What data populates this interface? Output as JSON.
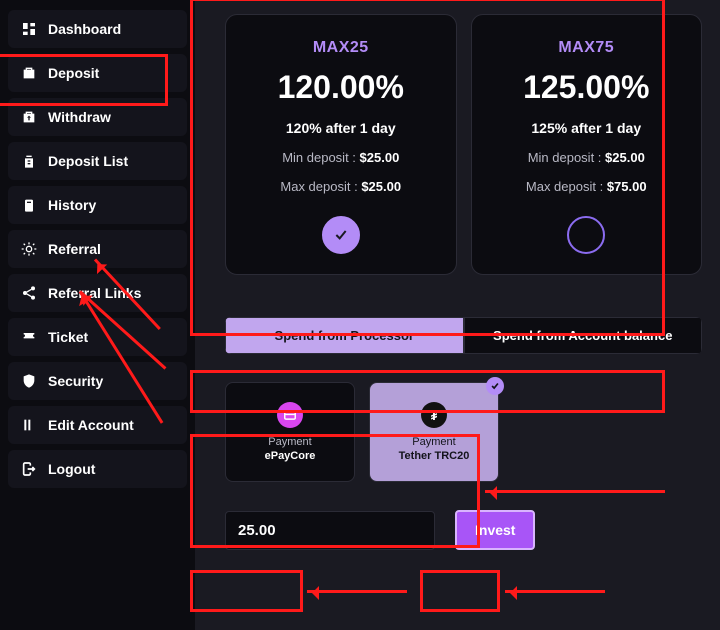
{
  "sidebar": {
    "items": [
      {
        "label": "Dashboard",
        "icon": "dashboard"
      },
      {
        "label": "Deposit",
        "icon": "deposit"
      },
      {
        "label": "Withdraw",
        "icon": "withdraw"
      },
      {
        "label": "Deposit List",
        "icon": "list"
      },
      {
        "label": "History",
        "icon": "history"
      },
      {
        "label": "Referral",
        "icon": "referral"
      },
      {
        "label": "Referral Links",
        "icon": "share"
      },
      {
        "label": "Ticket",
        "icon": "ticket"
      },
      {
        "label": "Security",
        "icon": "security"
      },
      {
        "label": "Edit Account",
        "icon": "edit"
      },
      {
        "label": "Logout",
        "icon": "logout"
      }
    ]
  },
  "plans": [
    {
      "name": "MAX25",
      "percent": "120.00%",
      "after": "120% after 1 day",
      "min_label": "Min deposit : ",
      "min_value": "$25.00",
      "max_label": "Max deposit : ",
      "max_value": "$25.00",
      "selected": true
    },
    {
      "name": "MAX75",
      "percent": "125.00%",
      "after": "125% after 1 day",
      "min_label": "Min deposit : ",
      "min_value": "$25.00",
      "max_label": "Max deposit : ",
      "max_value": "$75.00",
      "selected": false
    }
  ],
  "spend_options": {
    "processor": "Spend from Processor",
    "balance": "Spend from Account balance"
  },
  "processors": [
    {
      "label": "Payment",
      "name": "ePayCore",
      "icon": "epay",
      "selected": false
    },
    {
      "label": "Payment",
      "name": "Tether TRC20",
      "icon": "tether",
      "selected": true
    }
  ],
  "amount": "25.00",
  "invest_label": "Invest"
}
